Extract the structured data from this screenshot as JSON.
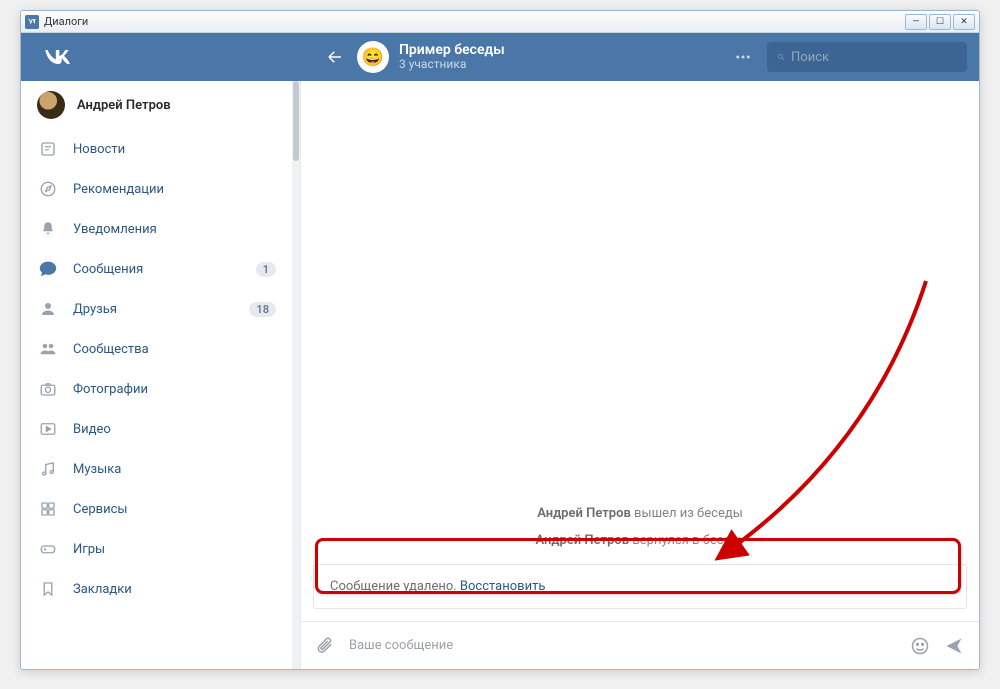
{
  "window": {
    "title": "Диалоги"
  },
  "topbar": {
    "chat_title": "Пример беседы",
    "chat_subtitle": "3 участника",
    "search_placeholder": "Поиск"
  },
  "sidebar": {
    "profile_name": "Андрей Петров",
    "items": [
      {
        "label": "Новости"
      },
      {
        "label": "Рекомендации"
      },
      {
        "label": "Уведомления"
      },
      {
        "label": "Сообщения",
        "badge": "1"
      },
      {
        "label": "Друзья",
        "badge": "18"
      },
      {
        "label": "Сообщества"
      },
      {
        "label": "Фотографии"
      },
      {
        "label": "Видео"
      },
      {
        "label": "Музыка"
      },
      {
        "label": "Сервисы"
      },
      {
        "label": "Игры"
      },
      {
        "label": "Закладки"
      }
    ]
  },
  "chat": {
    "sys1_name": "Андрей Петров",
    "sys1_action": " вышел из беседы",
    "sys2_name": "Андрей Петров",
    "sys2_action": " вернулся в беседу",
    "deleted_text": "Сообщение удалено. ",
    "restore_link": "Восстановить",
    "composer_placeholder": "Ваше сообщение"
  }
}
